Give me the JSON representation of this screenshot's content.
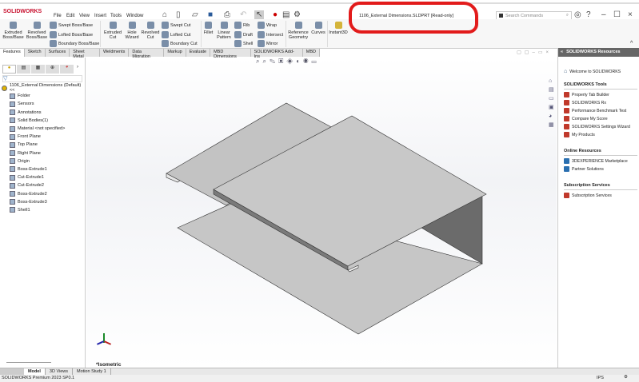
{
  "app": {
    "logo": "SOLIDWORKS",
    "document_title": "1106_External Dimensions.SLDPRT [Read-only]",
    "search_placeholder": "Search Commands"
  },
  "menu": [
    "File",
    "Edit",
    "View",
    "Insert",
    "Tools",
    "Window"
  ],
  "ribbon": {
    "large": [
      "Extruded Boss/Base",
      "Revolved Boss/Base",
      "Extruded Cut",
      "Hole Wizard",
      "Revolved Cut",
      "Fillet",
      "Linear Pattern",
      "Reference Geometry",
      "Curves",
      "Instant3D"
    ],
    "small": [
      "Swept Boss/Base",
      "Lofted Boss/Base",
      "Boundary Boss/Base",
      "Swept Cut",
      "Lofted Cut",
      "Boundary Cut",
      "Rib",
      "Draft",
      "Shell",
      "Wrap",
      "Intersect",
      "Mirror"
    ]
  },
  "tabs": [
    "Features",
    "Sketch",
    "Surfaces",
    "Sheet Metal",
    "Weldments",
    "Data Migration",
    "Markup",
    "Evaluate",
    "MBD Dimensions",
    "SOLIDWORKS Add-Ins",
    "MBD"
  ],
  "tree": [
    "1106_External Dimensions (Default) <<",
    "Folder",
    "Sensors",
    "Annotations",
    "Solid Bodies(1)",
    "Material <not specified>",
    "Front Plane",
    "Top Plane",
    "Right Plane",
    "Origin",
    "Boss-Extrude1",
    "Cut-Extrude1",
    "Cut-Extrude2",
    "Boss-Extrude2",
    "Boss-Extrude3",
    "Shell1"
  ],
  "viewport": {
    "view_label": "*Isometric"
  },
  "taskpane": {
    "title": "SOLIDWORKS Resources",
    "welcome": "Welcome to SOLIDWORKS",
    "sections": [
      {
        "title": "SOLIDWORKS Tools",
        "items": [
          "Property Tab Builder",
          "SOLIDWORKS Rx",
          "Performance Benchmark Test",
          "Compare My Score",
          "SOLIDWORKS Settings Wizard",
          "My Products"
        ]
      },
      {
        "title": "Online Resources",
        "items": [
          "3DEXPERIENCE Marketplace",
          "Partner Solutions"
        ]
      },
      {
        "title": "Subscription Services",
        "items": [
          "Subscription Services"
        ]
      }
    ]
  },
  "bottom_tabs": [
    "Model",
    "3D Views",
    "Motion Study 1"
  ],
  "status": {
    "left": "SOLIDWORKS Premium 2023 SP0.1",
    "units": "IPS"
  },
  "colors": {
    "annotation": "#e21b1b",
    "brand": "#c8102e"
  }
}
